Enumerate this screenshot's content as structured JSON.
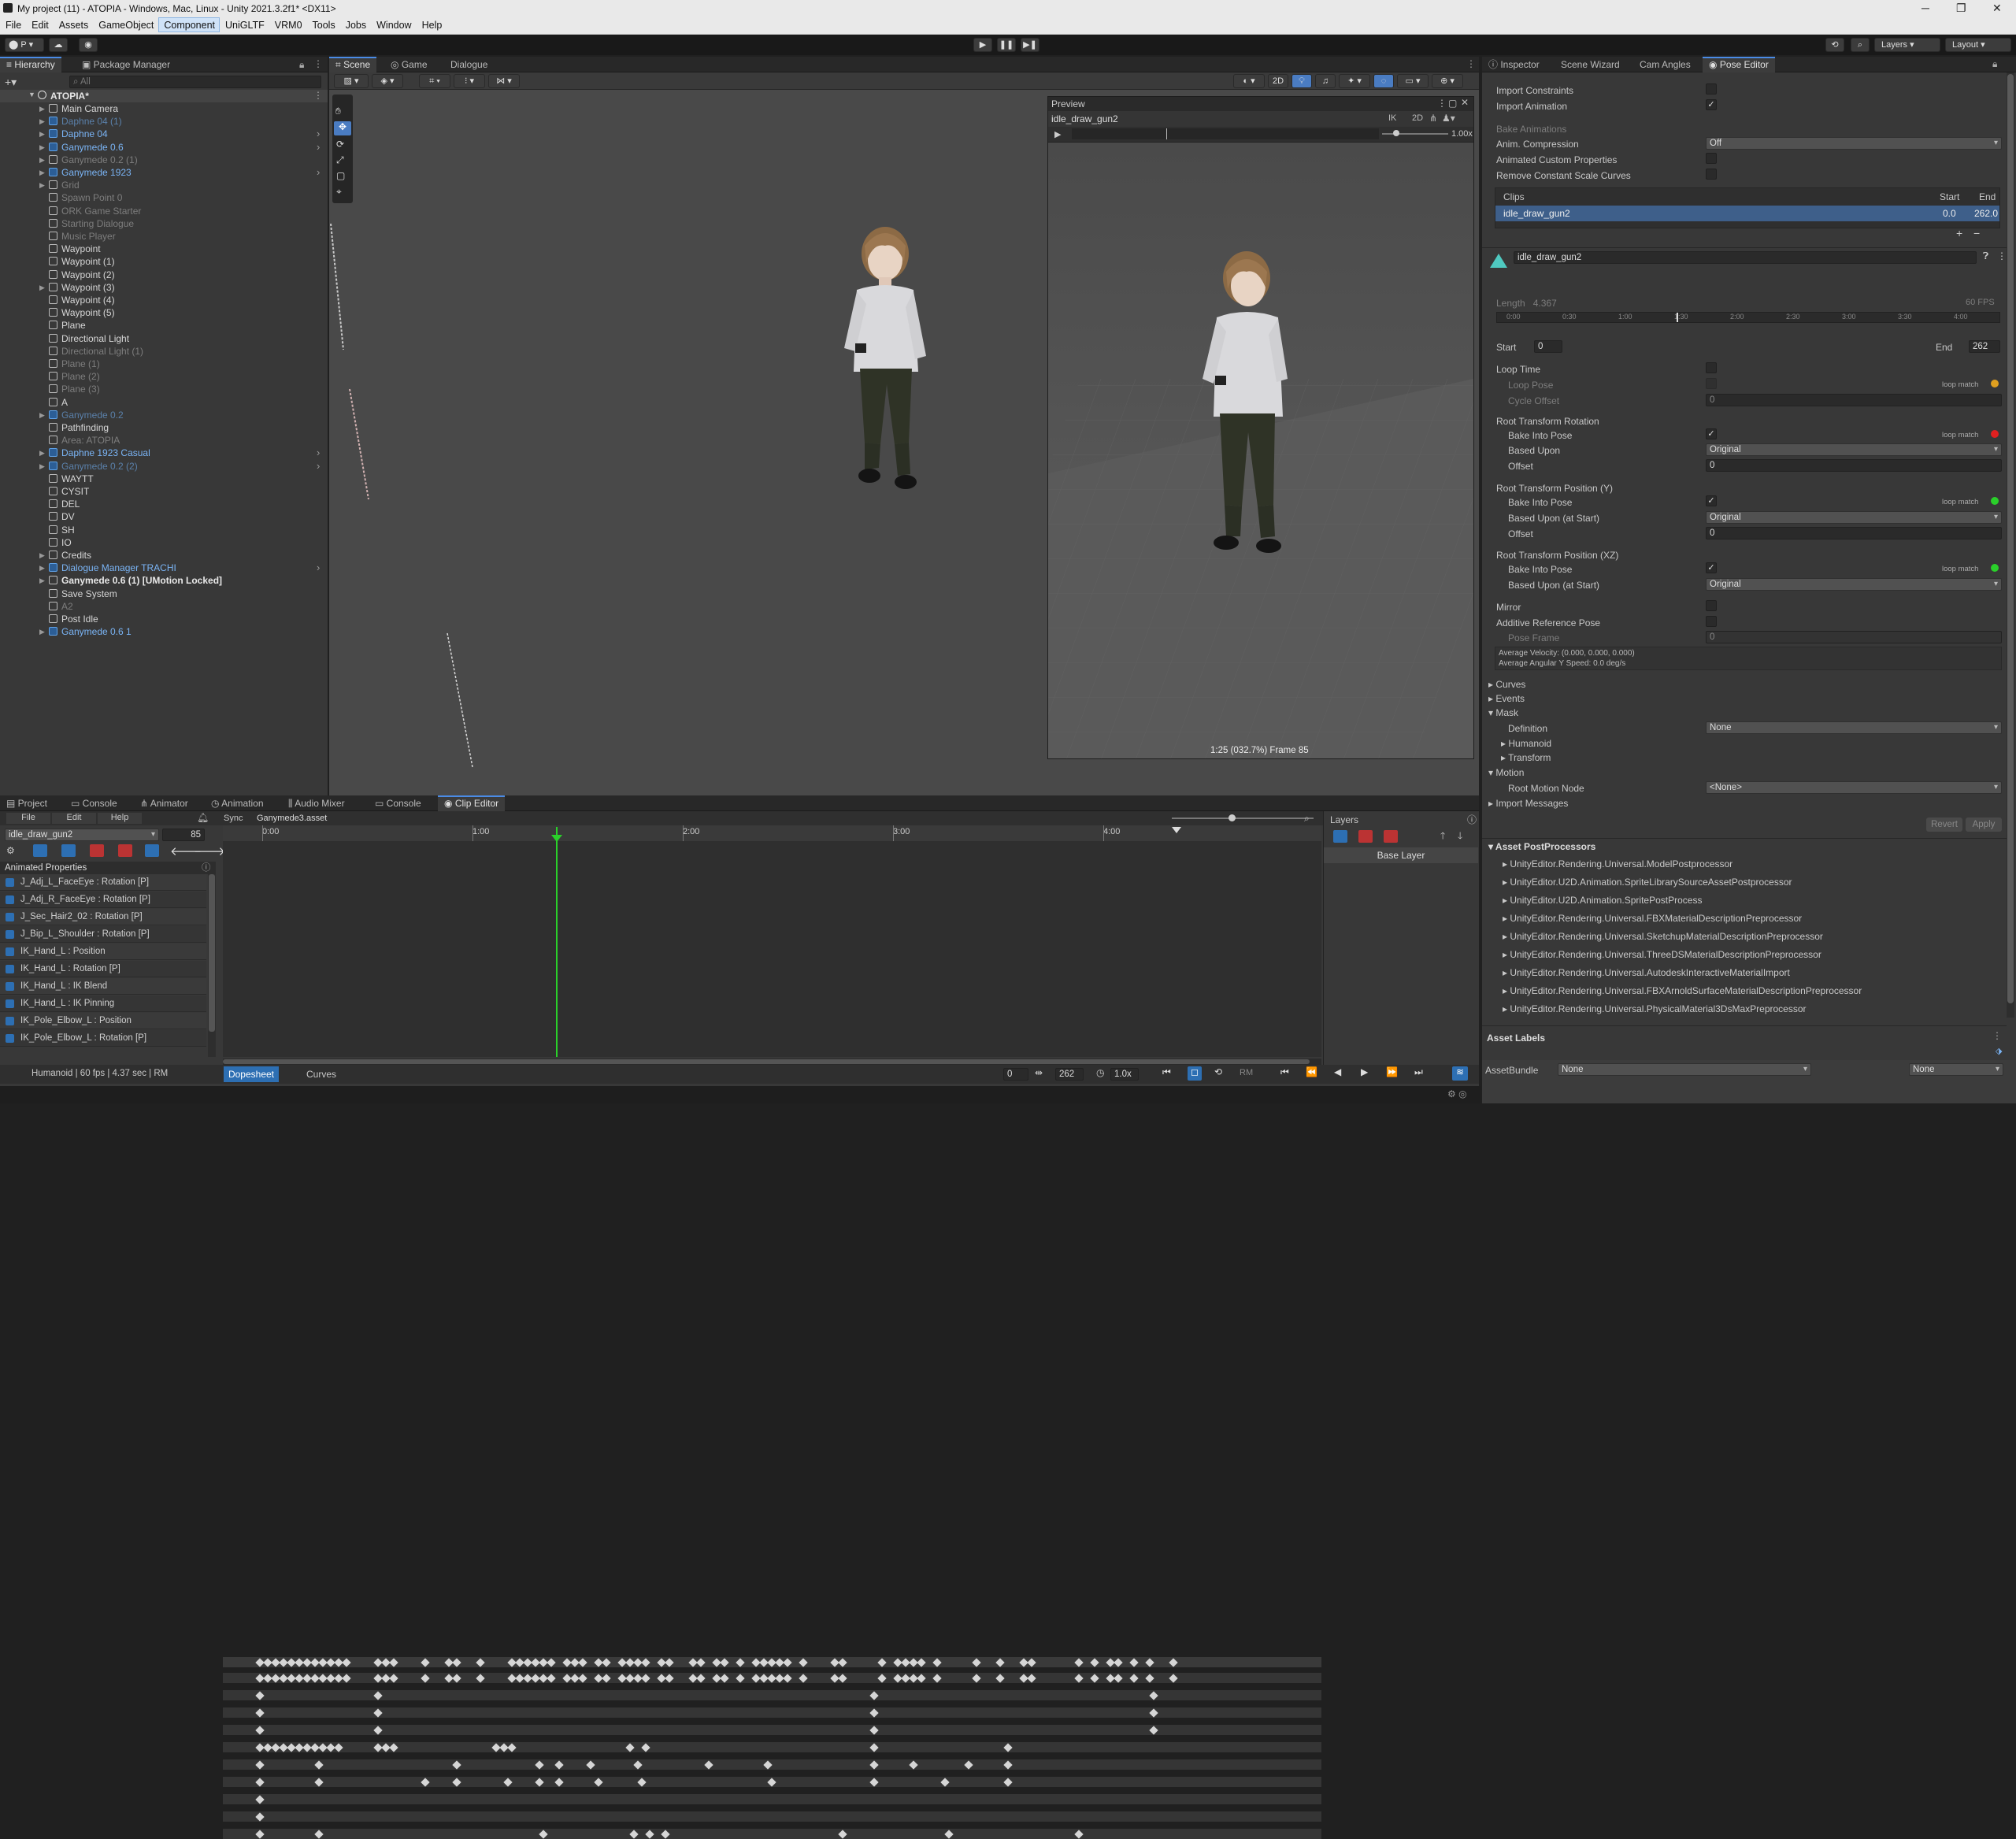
{
  "window": {
    "title": "My project (11) - ATOPIA - Windows, Mac, Linux - Unity 2021.3.2f1* <DX11>"
  },
  "menu": [
    "File",
    "Edit",
    "Assets",
    "GameObject",
    "Component",
    "UniGLTF",
    "VRM0",
    "Tools",
    "Jobs",
    "Window",
    "Help"
  ],
  "menu_selected": "Component",
  "toolbar": {
    "account": "P",
    "layers": "Layers",
    "layout": "Layout"
  },
  "hierarchy": {
    "tabs": [
      "Hierarchy",
      "Package Manager"
    ],
    "search_placeholder": "All",
    "scene": "ATOPIA*",
    "items": [
      {
        "label": "Main Camera",
        "color": "w",
        "arrow": "▶",
        "icon": "obj",
        "depth": 1
      },
      {
        "label": "Daphne 04 (1)",
        "color": "bd",
        "arrow": "▶",
        "icon": "pf",
        "depth": 1
      },
      {
        "label": "Daphne 04",
        "color": "b",
        "arrow": "▶",
        "icon": "pf",
        "depth": 1,
        "more": true
      },
      {
        "label": "Ganymede 0.6",
        "color": "b",
        "arrow": "▶",
        "icon": "pf",
        "depth": 1,
        "more": true
      },
      {
        "label": "Ganymede 0.2 (1)",
        "color": "g",
        "arrow": "▶",
        "icon": "obj",
        "depth": 1
      },
      {
        "label": "Ganymede 1923",
        "color": "b",
        "arrow": "▶",
        "icon": "pf",
        "depth": 1,
        "more": true
      },
      {
        "label": "Grid",
        "color": "g",
        "arrow": "▶",
        "icon": "obj",
        "depth": 1
      },
      {
        "label": "Spawn Point 0",
        "color": "g",
        "arrow": "",
        "icon": "obj",
        "depth": 1
      },
      {
        "label": "ORK Game Starter",
        "color": "g",
        "arrow": "",
        "icon": "obj",
        "depth": 1
      },
      {
        "label": "Starting Dialogue",
        "color": "g",
        "arrow": "",
        "icon": "obj",
        "depth": 1
      },
      {
        "label": "Music Player",
        "color": "g",
        "arrow": "",
        "icon": "obj",
        "depth": 1
      },
      {
        "label": "Waypoint",
        "color": "w",
        "arrow": "",
        "icon": "obj",
        "depth": 1
      },
      {
        "label": "Waypoint (1)",
        "color": "w",
        "arrow": "",
        "icon": "obj",
        "depth": 1
      },
      {
        "label": "Waypoint (2)",
        "color": "w",
        "arrow": "",
        "icon": "obj",
        "depth": 1
      },
      {
        "label": "Waypoint (3)",
        "color": "w",
        "arrow": "▶",
        "icon": "obj",
        "depth": 1
      },
      {
        "label": "Waypoint (4)",
        "color": "w",
        "arrow": "",
        "icon": "obj",
        "depth": 1
      },
      {
        "label": "Waypoint (5)",
        "color": "w",
        "arrow": "",
        "icon": "obj",
        "depth": 1
      },
      {
        "label": "Plane",
        "color": "w",
        "arrow": "",
        "icon": "obj",
        "depth": 1
      },
      {
        "label": "Directional Light",
        "color": "w",
        "arrow": "",
        "icon": "obj",
        "depth": 1
      },
      {
        "label": "Directional Light (1)",
        "color": "g",
        "arrow": "",
        "icon": "obj",
        "depth": 1
      },
      {
        "label": "Plane (1)",
        "color": "g",
        "arrow": "",
        "icon": "obj",
        "depth": 1
      },
      {
        "label": "Plane (2)",
        "color": "g",
        "arrow": "",
        "icon": "obj",
        "depth": 1
      },
      {
        "label": "Plane (3)",
        "color": "g",
        "arrow": "",
        "icon": "obj",
        "depth": 1
      },
      {
        "label": "A",
        "color": "w",
        "arrow": "",
        "icon": "obj",
        "depth": 1
      },
      {
        "label": "Ganymede 0.2",
        "color": "bd",
        "arrow": "▶",
        "icon": "pf",
        "depth": 1
      },
      {
        "label": "Pathfinding",
        "color": "w",
        "arrow": "",
        "icon": "obj",
        "depth": 1
      },
      {
        "label": "Area: ATOPIA",
        "color": "g",
        "arrow": "",
        "icon": "obj",
        "depth": 1
      },
      {
        "label": "Daphne 1923 Casual",
        "color": "b",
        "arrow": "▶",
        "icon": "pf",
        "depth": 1,
        "more": true
      },
      {
        "label": "Ganymede 0.2 (2)",
        "color": "bd",
        "arrow": "▶",
        "icon": "pf",
        "depth": 1,
        "more": true
      },
      {
        "label": "WAYTT",
        "color": "w",
        "arrow": "",
        "icon": "obj",
        "depth": 1
      },
      {
        "label": "CYSIT",
        "color": "w",
        "arrow": "",
        "icon": "obj",
        "depth": 1
      },
      {
        "label": "DEL",
        "color": "w",
        "arrow": "",
        "icon": "obj",
        "depth": 1
      },
      {
        "label": "DV",
        "color": "w",
        "arrow": "",
        "icon": "obj",
        "depth": 1
      },
      {
        "label": "SH",
        "color": "w",
        "arrow": "",
        "icon": "obj",
        "depth": 1
      },
      {
        "label": "IO",
        "color": "w",
        "arrow": "",
        "icon": "obj",
        "depth": 1
      },
      {
        "label": "Credits",
        "color": "w",
        "arrow": "▶",
        "icon": "obj",
        "depth": 1
      },
      {
        "label": "Dialogue Manager TRACHI",
        "color": "b",
        "arrow": "▶",
        "icon": "pf",
        "depth": 1,
        "more": true
      },
      {
        "label": "Ganymede 0.6 (1) [UMotion Locked]",
        "color": "wb",
        "arrow": "▶",
        "icon": "obj",
        "depth": 1
      },
      {
        "label": "Save System",
        "color": "w",
        "arrow": "",
        "icon": "obj",
        "depth": 1
      },
      {
        "label": "A2",
        "color": "g",
        "arrow": "",
        "icon": "obj",
        "depth": 1
      },
      {
        "label": "Post Idle",
        "color": "w",
        "arrow": "",
        "icon": "obj",
        "depth": 1
      },
      {
        "label": "Ganymede 0.6 1",
        "color": "b",
        "arrow": "▶",
        "icon": "pf",
        "depth": 1
      }
    ]
  },
  "scene_view": {
    "tabs": [
      "Scene",
      "Game",
      "Dialogue"
    ],
    "mode_2d": "2D"
  },
  "preview": {
    "title": "Preview",
    "clip": "idle_draw_gun2",
    "ik": "IK",
    "mode_2d": "2D",
    "speed": "1.00x",
    "status": "1:25 (032.7%) Frame 85"
  },
  "inspector": {
    "tabs": [
      "Inspector",
      "Scene Wizard",
      "Cam Angles",
      "Pose Editor"
    ],
    "import_constraints": "Import Constraints",
    "import_animation": "Import Animation",
    "bake_animations": "Bake Animations",
    "anim_compression": "Anim. Compression",
    "anim_compression_value": "Off",
    "animated_custom": "Animated Custom Properties",
    "remove_scale": "Remove Constant Scale Curves",
    "clips_header": "Clips",
    "start_header": "Start",
    "end_header": "End",
    "clip_name": "idle_draw_gun2",
    "clip_start": "0.0",
    "clip_end": "262.0",
    "clip_field": "idle_draw_gun2",
    "length_label": "Length",
    "length_value": "4.367",
    "fps": "60 FPS",
    "ruler": [
      "0:00",
      "0:30",
      "1:00",
      "1:30",
      "2:00",
      "2:30",
      "3:00",
      "3:30",
      "4:00"
    ],
    "start_label": "Start",
    "start_value": "0",
    "end_label": "End",
    "end_value": "262",
    "loop_time": "Loop Time",
    "loop_pose": "Loop Pose",
    "cycle_offset": "Cycle Offset",
    "cycle_offset_value": "0",
    "loop_match": "loop match",
    "rtr": "Root Transform Rotation",
    "bake_into_pose": "Bake Into Pose",
    "based_upon": "Based Upon",
    "based_upon_value": "Original",
    "offset": "Offset",
    "offset_value": "0",
    "rtpy": "Root Transform Position (Y)",
    "based_upon_start": "Based Upon (at Start)",
    "rtpxz": "Root Transform Position (XZ)",
    "mirror": "Mirror",
    "additive": "Additive Reference Pose",
    "pose_frame": "Pose Frame",
    "pose_frame_value": "0",
    "avg_velocity": "Average Velocity: (0.000, 0.000, 0.000)",
    "avg_angular": "Average Angular Y Speed: 0.0 deg/s",
    "curves": "Curves",
    "events": "Events",
    "mask": "Mask",
    "definition": "Definition",
    "definition_value": "None",
    "humanoid": "Humanoid",
    "transform": "Transform",
    "motion": "Motion",
    "root_motion_node": "Root Motion Node",
    "root_motion_value": "<None>",
    "import_messages": "Import Messages",
    "revert": "Revert",
    "apply": "Apply",
    "asset_post": "Asset PostProcessors",
    "postprocessors": [
      "UnityEditor.Rendering.Universal.ModelPostprocessor",
      "UnityEditor.U2D.Animation.SpriteLibrarySourceAssetPostprocessor",
      "UnityEditor.U2D.Animation.SpritePostProcess",
      "UnityEditor.Rendering.Universal.FBXMaterialDescriptionPreprocessor",
      "UnityEditor.Rendering.Universal.SketchupMaterialDescriptionPreprocessor",
      "UnityEditor.Rendering.Universal.ThreeDSMaterialDescriptionPreprocessor",
      "UnityEditor.Rendering.Universal.AutodeskInteractiveMaterialImport",
      "UnityEditor.Rendering.Universal.FBXArnoldSurfaceMaterialDescriptionPreprocessor",
      "UnityEditor.Rendering.Universal.PhysicalMaterial3DsMaxPreprocessor"
    ],
    "asset_labels": "Asset Labels",
    "asset_bundle": "AssetBundle",
    "asset_bundle_value": "None",
    "asset_bundle_variant": "None"
  },
  "bottom": {
    "tabs": [
      "Project",
      "Console",
      "Animator",
      "Animation",
      "Audio Mixer",
      "Console",
      "Clip Editor"
    ],
    "menu": [
      "File",
      "Edit",
      "Help"
    ],
    "sync": "Sync",
    "asset": "Ganymede3.asset",
    "clip": "idle_draw_gun2",
    "frame": "85",
    "animated_props": "Animated Properties",
    "tracks": [
      "J_Adj_L_FaceEye : Rotation [P]",
      "J_Adj_R_FaceEye : Rotation [P]",
      "J_Sec_Hair2_02 : Rotation [P]",
      "J_Bip_L_Shoulder : Rotation [P]",
      "IK_Hand_L : Position",
      "IK_Hand_L : Rotation [P]",
      "IK_Hand_L : IK Blend",
      "IK_Hand_L : IK Pinning",
      "IK_Pole_Elbow_L : Position",
      "IK_Pole_Elbow_L : Rotation [P]"
    ],
    "timeline_ticks": [
      "0:00",
      "1:00",
      "2:00",
      "3:00",
      "4:00"
    ],
    "layers": "Layers",
    "base_layer": "Base Layer",
    "status": "Humanoid | 60 fps | 4.37 sec | RM",
    "dopesheet": "Dopesheet",
    "curves": "Curves",
    "start_field": "0",
    "end_field": "262",
    "speed": "1.0x",
    "rm": "RM"
  }
}
